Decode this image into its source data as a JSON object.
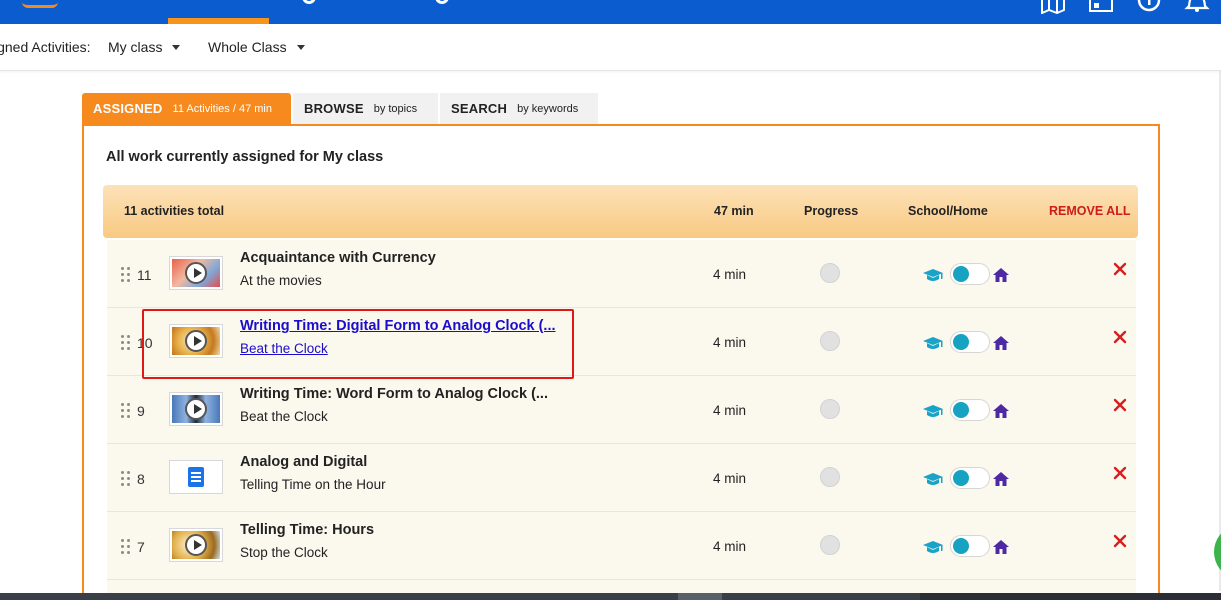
{
  "filters": {
    "label": "igned Activities:",
    "class_select": "My class",
    "scope_select": "Whole Class"
  },
  "tabs": [
    {
      "label": "ASSIGNED",
      "sub": "11 Activities / 47 min"
    },
    {
      "label": "BROWSE",
      "sub": "by topics"
    },
    {
      "label": "SEARCH",
      "sub": "by keywords"
    }
  ],
  "panel": {
    "title": "All work currently assigned for My class"
  },
  "table_header": {
    "total": "11 activities total",
    "time": "47 min",
    "progress": "Progress",
    "school_home": "School/Home",
    "remove_all": "REMOVE ALL"
  },
  "rows": [
    {
      "num": "11",
      "title": "Acquaintance with Currency",
      "subtitle": "At the movies",
      "time": "4 min",
      "thumb": "video-movies-thumb"
    },
    {
      "num": "10",
      "title": "Writing Time: Digital Form to Analog Clock (...",
      "subtitle": "Beat the Clock",
      "time": "4 min",
      "thumb": "video-clock-thumb"
    },
    {
      "num": "9",
      "title": "Writing Time: Word Form to Analog Clock (...",
      "subtitle": "Beat the Clock",
      "time": "4 min",
      "thumb": "video-clock-thumb"
    },
    {
      "num": "8",
      "title": "Analog and Digital",
      "subtitle": "Telling Time on the Hour",
      "time": "4 min",
      "thumb": "document-thumb"
    },
    {
      "num": "7",
      "title": "Telling Time: Hours",
      "subtitle": "Stop the Clock",
      "time": "4 min",
      "thumb": "video-clock-thumb"
    }
  ],
  "colors": {
    "topbar": "#0a5ccf",
    "accent_orange": "#f68a1f",
    "toggle_teal": "#16a3c2",
    "remove_red": "#d81e1e",
    "link_blue": "#1a0dcc"
  },
  "icons": {
    "drag": "drag-handle-icon",
    "play": "play-icon",
    "document": "document-icon",
    "school": "graduation-cap-icon",
    "home": "home-icon",
    "remove": "close-icon",
    "top": [
      "map-icon",
      "presentation-icon",
      "help-icon",
      "bell-icon"
    ]
  }
}
